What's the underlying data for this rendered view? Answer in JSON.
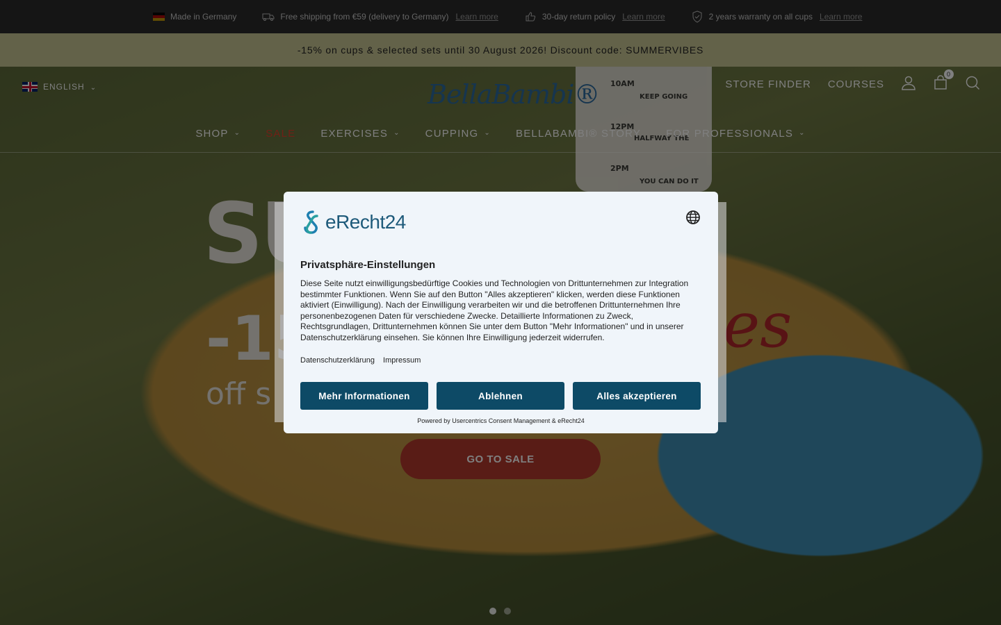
{
  "infobar": {
    "made_in": "Made in Germany",
    "shipping": "Free shipping from €59 (delivery to Germany)",
    "shipping_link": "Learn more",
    "returns": "30-day return policy",
    "returns_link": "Learn more",
    "warranty": "2 years warranty on all cups",
    "warranty_link": "Learn more"
  },
  "promo": {
    "text": "-15% on cups & selected sets until 30 August 2026! Discount code: SUMMERVIBES"
  },
  "header": {
    "language": "ENGLISH",
    "logo": "BellaBambi®",
    "store_finder": "STORE FINDER",
    "courses": "COURSES",
    "cart_count": "0"
  },
  "nav": {
    "shop": "SHOP",
    "sale": "SALE",
    "exercises": "EXERCISES",
    "cupping": "CUPPING",
    "story": "BELLABAMBI® STORY",
    "professionals": "FOR PROFESSIONALS"
  },
  "hero": {
    "title": "SU",
    "discount": "-15",
    "off": "off s",
    "vibes": "es",
    "cta": "GO TO SALE",
    "bottle_marks": [
      "10AM",
      "12PM",
      "2PM"
    ],
    "bottle_words": [
      "KEEP GOING",
      "HALFWAY THE",
      "YOU CAN DO IT"
    ]
  },
  "consent": {
    "logo_text": "eRecht24",
    "title": "Privatsphäre-Einstellungen",
    "body": "Diese Seite nutzt einwilligungsbedürftige Cookies und Technologien von Drittunternehmen zur Integration bestimmter Funktionen. Wenn Sie auf den Button \"Alles akzeptieren\" klicken, werden diese Funktionen aktiviert (Einwilligung). Nach der Einwilligung verarbeiten wir und die betroffenen Drittunternehmen Ihre personenbezogenen Daten für verschiedene Zwecke. Detaillierte Informationen zu Zweck, Rechtsgrundlagen, Drittunternehmen können Sie unter dem Button \"Mehr Informationen\" und in unserer Datenschutzerklärung einsehen. Sie können Ihre Einwilligung jederzeit widerrufen.",
    "link_privacy": "Datenschutzerklärung",
    "link_imprint": "Impressum",
    "btn_more": "Mehr Informationen",
    "btn_decline": "Ablehnen",
    "btn_accept": "Alles akzeptieren",
    "powered": "Powered by Usercentrics Consent Management & eRecht24"
  },
  "colors": {
    "infobar_bg": "#2b2b2b",
    "promo_bg": "#c7c592",
    "button_bg": "#0d4a66",
    "sale_red": "#e0402c",
    "cta_red": "#b3392c"
  }
}
